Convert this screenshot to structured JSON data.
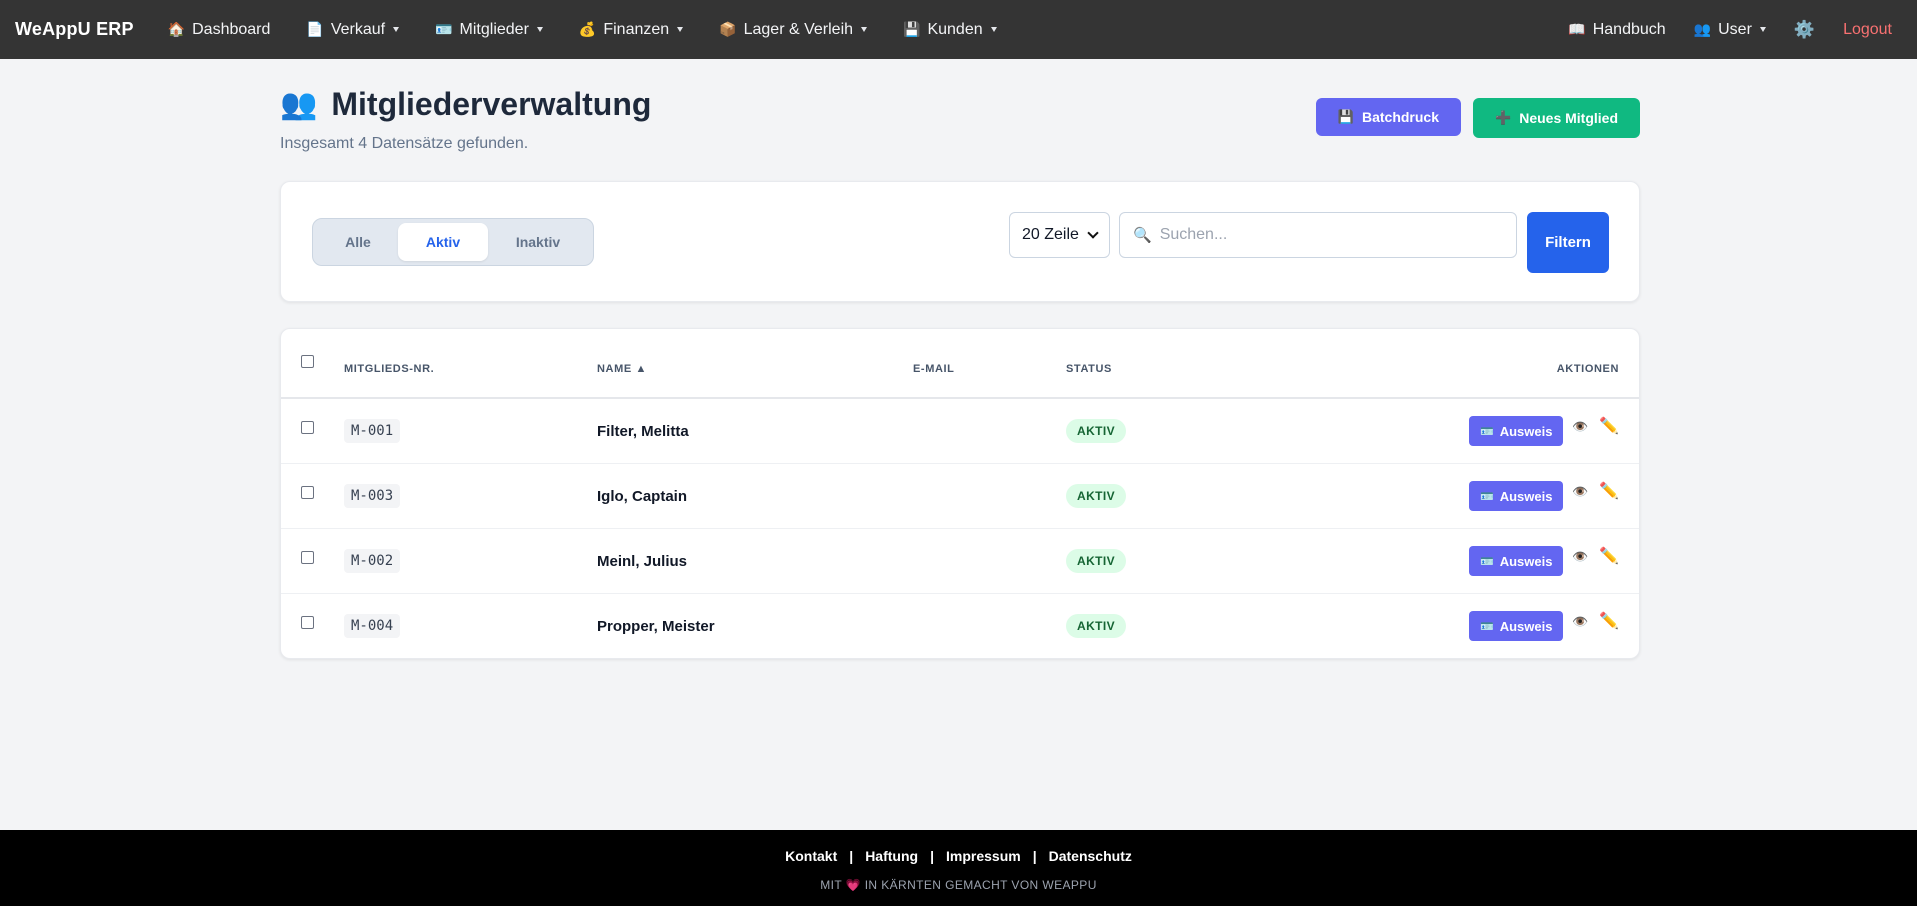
{
  "navbar": {
    "brand": "WeAppU ERP",
    "items": [
      {
        "icon": "🏠",
        "label": "Dashboard",
        "dropdown": false
      },
      {
        "icon": "📄",
        "label": "Verkauf",
        "dropdown": true
      },
      {
        "icon": "🪪",
        "label": "Mitglieder",
        "dropdown": true
      },
      {
        "icon": "💰",
        "label": "Finanzen",
        "dropdown": true
      },
      {
        "icon": "📦",
        "label": "Lager & Verleih",
        "dropdown": true
      },
      {
        "icon": "💾",
        "label": "Kunden",
        "dropdown": true
      }
    ],
    "handbook": {
      "icon": "📖",
      "label": "Handbuch"
    },
    "user": {
      "icon": "👥",
      "label": "User"
    },
    "gear_icon": "⚙️",
    "logout": "Logout"
  },
  "header": {
    "icon": "👥",
    "title": "Mitgliederverwaltung",
    "subtitle": "Insgesamt 4 Datensätze gefunden.",
    "batch_button": {
      "icon": "💾",
      "label": "Batchdruck"
    },
    "new_button": {
      "icon": "➕",
      "label": "Neues Mitglied"
    }
  },
  "filter": {
    "tabs": {
      "all": "Alle",
      "active": "Aktiv",
      "inactive": "Inaktiv"
    },
    "selected_tab": "Aktiv",
    "rows_select": "20 Zeile",
    "search_icon": "🔍",
    "search_placeholder": "Suchen...",
    "filter_button": "Filtern"
  },
  "table": {
    "columns": {
      "member_no": "MITGLIEDS-NR.",
      "name": "NAME ▲",
      "email": "E-MAIL",
      "status": "STATUS",
      "actions": "AKTIONEN"
    },
    "rows": [
      {
        "member_no": "M-001",
        "name": "Filter, Melitta",
        "email": "",
        "status": "AKTIV"
      },
      {
        "member_no": "M-003",
        "name": "Iglo, Captain",
        "email": "",
        "status": "AKTIV"
      },
      {
        "member_no": "M-002",
        "name": "Meinl, Julius",
        "email": "",
        "status": "AKTIV"
      },
      {
        "member_no": "M-004",
        "name": "Propper, Meister",
        "email": "",
        "status": "AKTIV"
      }
    ],
    "id_button": {
      "icon": "🪪",
      "label": "Ausweis"
    },
    "view_icon": "👁️",
    "edit_icon": "✏️"
  },
  "footer": {
    "links": {
      "contact": "Kontakt",
      "liability": "Haftung",
      "imprint": "Impressum",
      "privacy": "Datenschutz"
    },
    "separator": "|",
    "note_prefix": "MIT",
    "heart": "💗",
    "note_suffix": "IN KÄRNTEN GEMACHT VON WEAPPU"
  },
  "colors": {
    "navbar_bg": "#343434",
    "primary": "#2563eb",
    "indigo": "#6366f1",
    "success": "#10b981",
    "logout": "#f87171"
  }
}
